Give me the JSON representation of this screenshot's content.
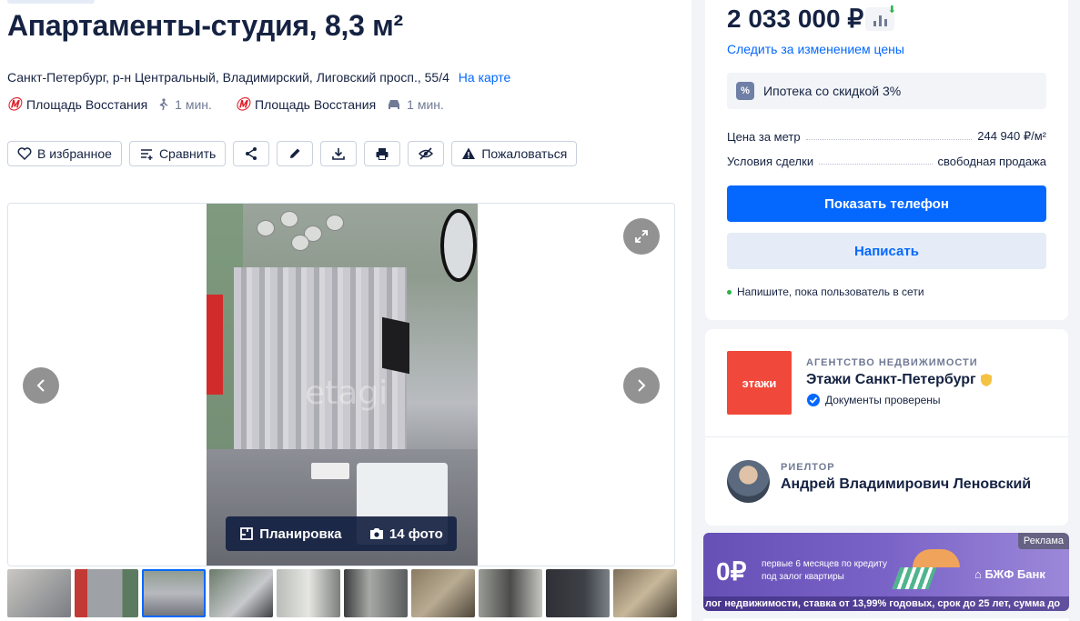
{
  "listing": {
    "title": "Апартаменты-студия, 8,3 м²",
    "address": "Санкт-Петербург, р-н Центральный, Владимирский, Лиговский просп., 55/4",
    "map_link": "На карте",
    "metro": [
      {
        "station": "Площадь Восстания",
        "time": "1 мин.",
        "mode": "walk-icon"
      },
      {
        "station": "Площадь Восстания",
        "time": "1 мин.",
        "mode": "car-icon"
      }
    ]
  },
  "actions": {
    "favorite": "В избранное",
    "compare": "Сравнить",
    "complain": "Пожаловаться"
  },
  "gallery": {
    "watermark": "etagi",
    "plan_label": "Планировка",
    "photos_label": "14 фото",
    "thumbs_count": 10,
    "active_thumb": 3
  },
  "price_card": {
    "price": "2 033 000 ₽",
    "follow": "Следить за изменением цены",
    "mortgage": "Ипотека со скидкой 3%",
    "mortgage_icon": "%",
    "price_per_meter_label": "Цена за метр",
    "price_per_meter": "244 940 ₽/м²",
    "deal_label": "Условия сделки",
    "deal_value": "свободная продажа",
    "show_phone": "Показать телефон",
    "write": "Написать",
    "online_note": "Напишите, пока пользователь в сети"
  },
  "agency": {
    "label": "АГЕНТСТВО НЕДВИЖИМОСТИ",
    "logo_text": "этажи",
    "name": "Этажи Санкт-Петербург",
    "docs": "Документы проверены",
    "realtor_label": "РИЕЛТОР",
    "realtor_name": "Андрей Владимирович Леновский"
  },
  "ad": {
    "tag": "Реклама",
    "big": "0₽",
    "small": "первые 6 месяцев по кредиту под залог квартиры",
    "bank": "БЖФ Банк",
    "ticker": "лог недвижимости, ставка от 13,99% годовых, срок до 25 лет, сумма до"
  },
  "colors": {
    "accent": "#0468ff",
    "text": "#152242",
    "muted": "#707a95",
    "agency_red": "#f0483a",
    "metro_red": "#e0202b"
  }
}
